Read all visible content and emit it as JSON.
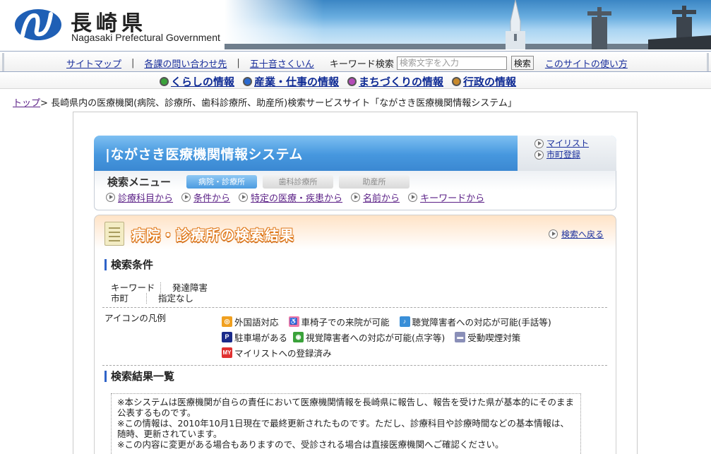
{
  "header": {
    "logo_kanji": "長崎県",
    "logo_english": "Nagasaki Prefectural Government",
    "logo_icon": "nagasaki-emblem",
    "photo": "church-and-cross-skyline"
  },
  "topbar": {
    "links": [
      "サイトマップ",
      "各課の問い合わせ先",
      "五十音さくいん"
    ],
    "separator": "|",
    "keyword_label": "キーワード検索",
    "search_placeholder": "検索文字を入力",
    "search_button": "検索",
    "howto_link": "このサイトの使い方"
  },
  "category_nav": [
    {
      "label": "くらしの情報",
      "color": "#3aa23a"
    },
    {
      "label": "産業・仕事の情報",
      "color": "#2a6ad0"
    },
    {
      "label": "まちづくりの情報",
      "color": "#b44bb8"
    },
    {
      "label": "行政の情報",
      "color": "#c8892a"
    }
  ],
  "breadcrumb": {
    "home": "トップ",
    "separator": ">",
    "current": "長崎県内の医療機関(病院、診療所、歯科診療所、助産所)検索サービスサイト「ながさき医療機関情報システム」"
  },
  "system": {
    "title": "|ながさき医療機関情報システム",
    "mylist_link": "マイリスト",
    "town_link": "市町登録"
  },
  "search_menu": {
    "title": "検索メニュー",
    "tabs": [
      {
        "label": "病院・診療所",
        "active": true
      },
      {
        "label": "歯科診療所",
        "active": false
      },
      {
        "label": "助産所",
        "active": false
      }
    ],
    "links": [
      "診療科目から",
      "条件から",
      "特定の医療・疾患から",
      "名前から",
      "キーワードから"
    ]
  },
  "results": {
    "title": "病院・診療所の検索結果",
    "back_link": "検索へ戻る",
    "conditions_heading": "検索条件",
    "conditions": [
      {
        "key": "キーワード",
        "value": "発達障害"
      },
      {
        "key": "市町",
        "value": "指定なし"
      }
    ],
    "legend_label": "アイコンの凡例",
    "legend_row1": [
      {
        "icon": "foreign-language-icon",
        "symbol": "",
        "color": "#f0a020",
        "label": "外国語対応"
      },
      {
        "icon": "wheelchair-icon",
        "symbol": "",
        "color": "#f07aa8",
        "label": "車椅子での来院が可能"
      },
      {
        "icon": "hearing-impaired-icon",
        "symbol": "",
        "color": "#3a8fd8",
        "label": "聴覚障害者への対応が可能(手話等)"
      }
    ],
    "legend_row2": [
      {
        "icon": "parking-icon",
        "symbol": "P",
        "color": "#1a2a8a",
        "label": "駐車場がある"
      },
      {
        "icon": "visually-impaired-icon",
        "symbol": "",
        "color": "#3aa23a",
        "label": "視覚障害者への対応が可能(点字等)"
      },
      {
        "icon": "no-smoking-icon",
        "symbol": "",
        "color": "#8a8fb8",
        "label": "受動喫煙対策"
      }
    ],
    "legend_row3": [
      {
        "icon": "mylist-registered-icon",
        "symbol": "MY",
        "color": "#e03030",
        "label": "マイリストへの登録済み"
      }
    ],
    "list_heading": "検索結果一覧",
    "notices": [
      "※本システムは医療機関が自らの責任において医療機関情報を長崎県に報告し、報告を受けた県が基本的にそのまま公表するものです。",
      "※この情報は、2010年10月1日現在で最終更新されたものです。ただし、診療科目や診療時間などの基本情報は、随時、更新されています。",
      "※この内容に変更がある場合もありますので、受診される場合は直接医療機関へご確認ください。"
    ]
  }
}
